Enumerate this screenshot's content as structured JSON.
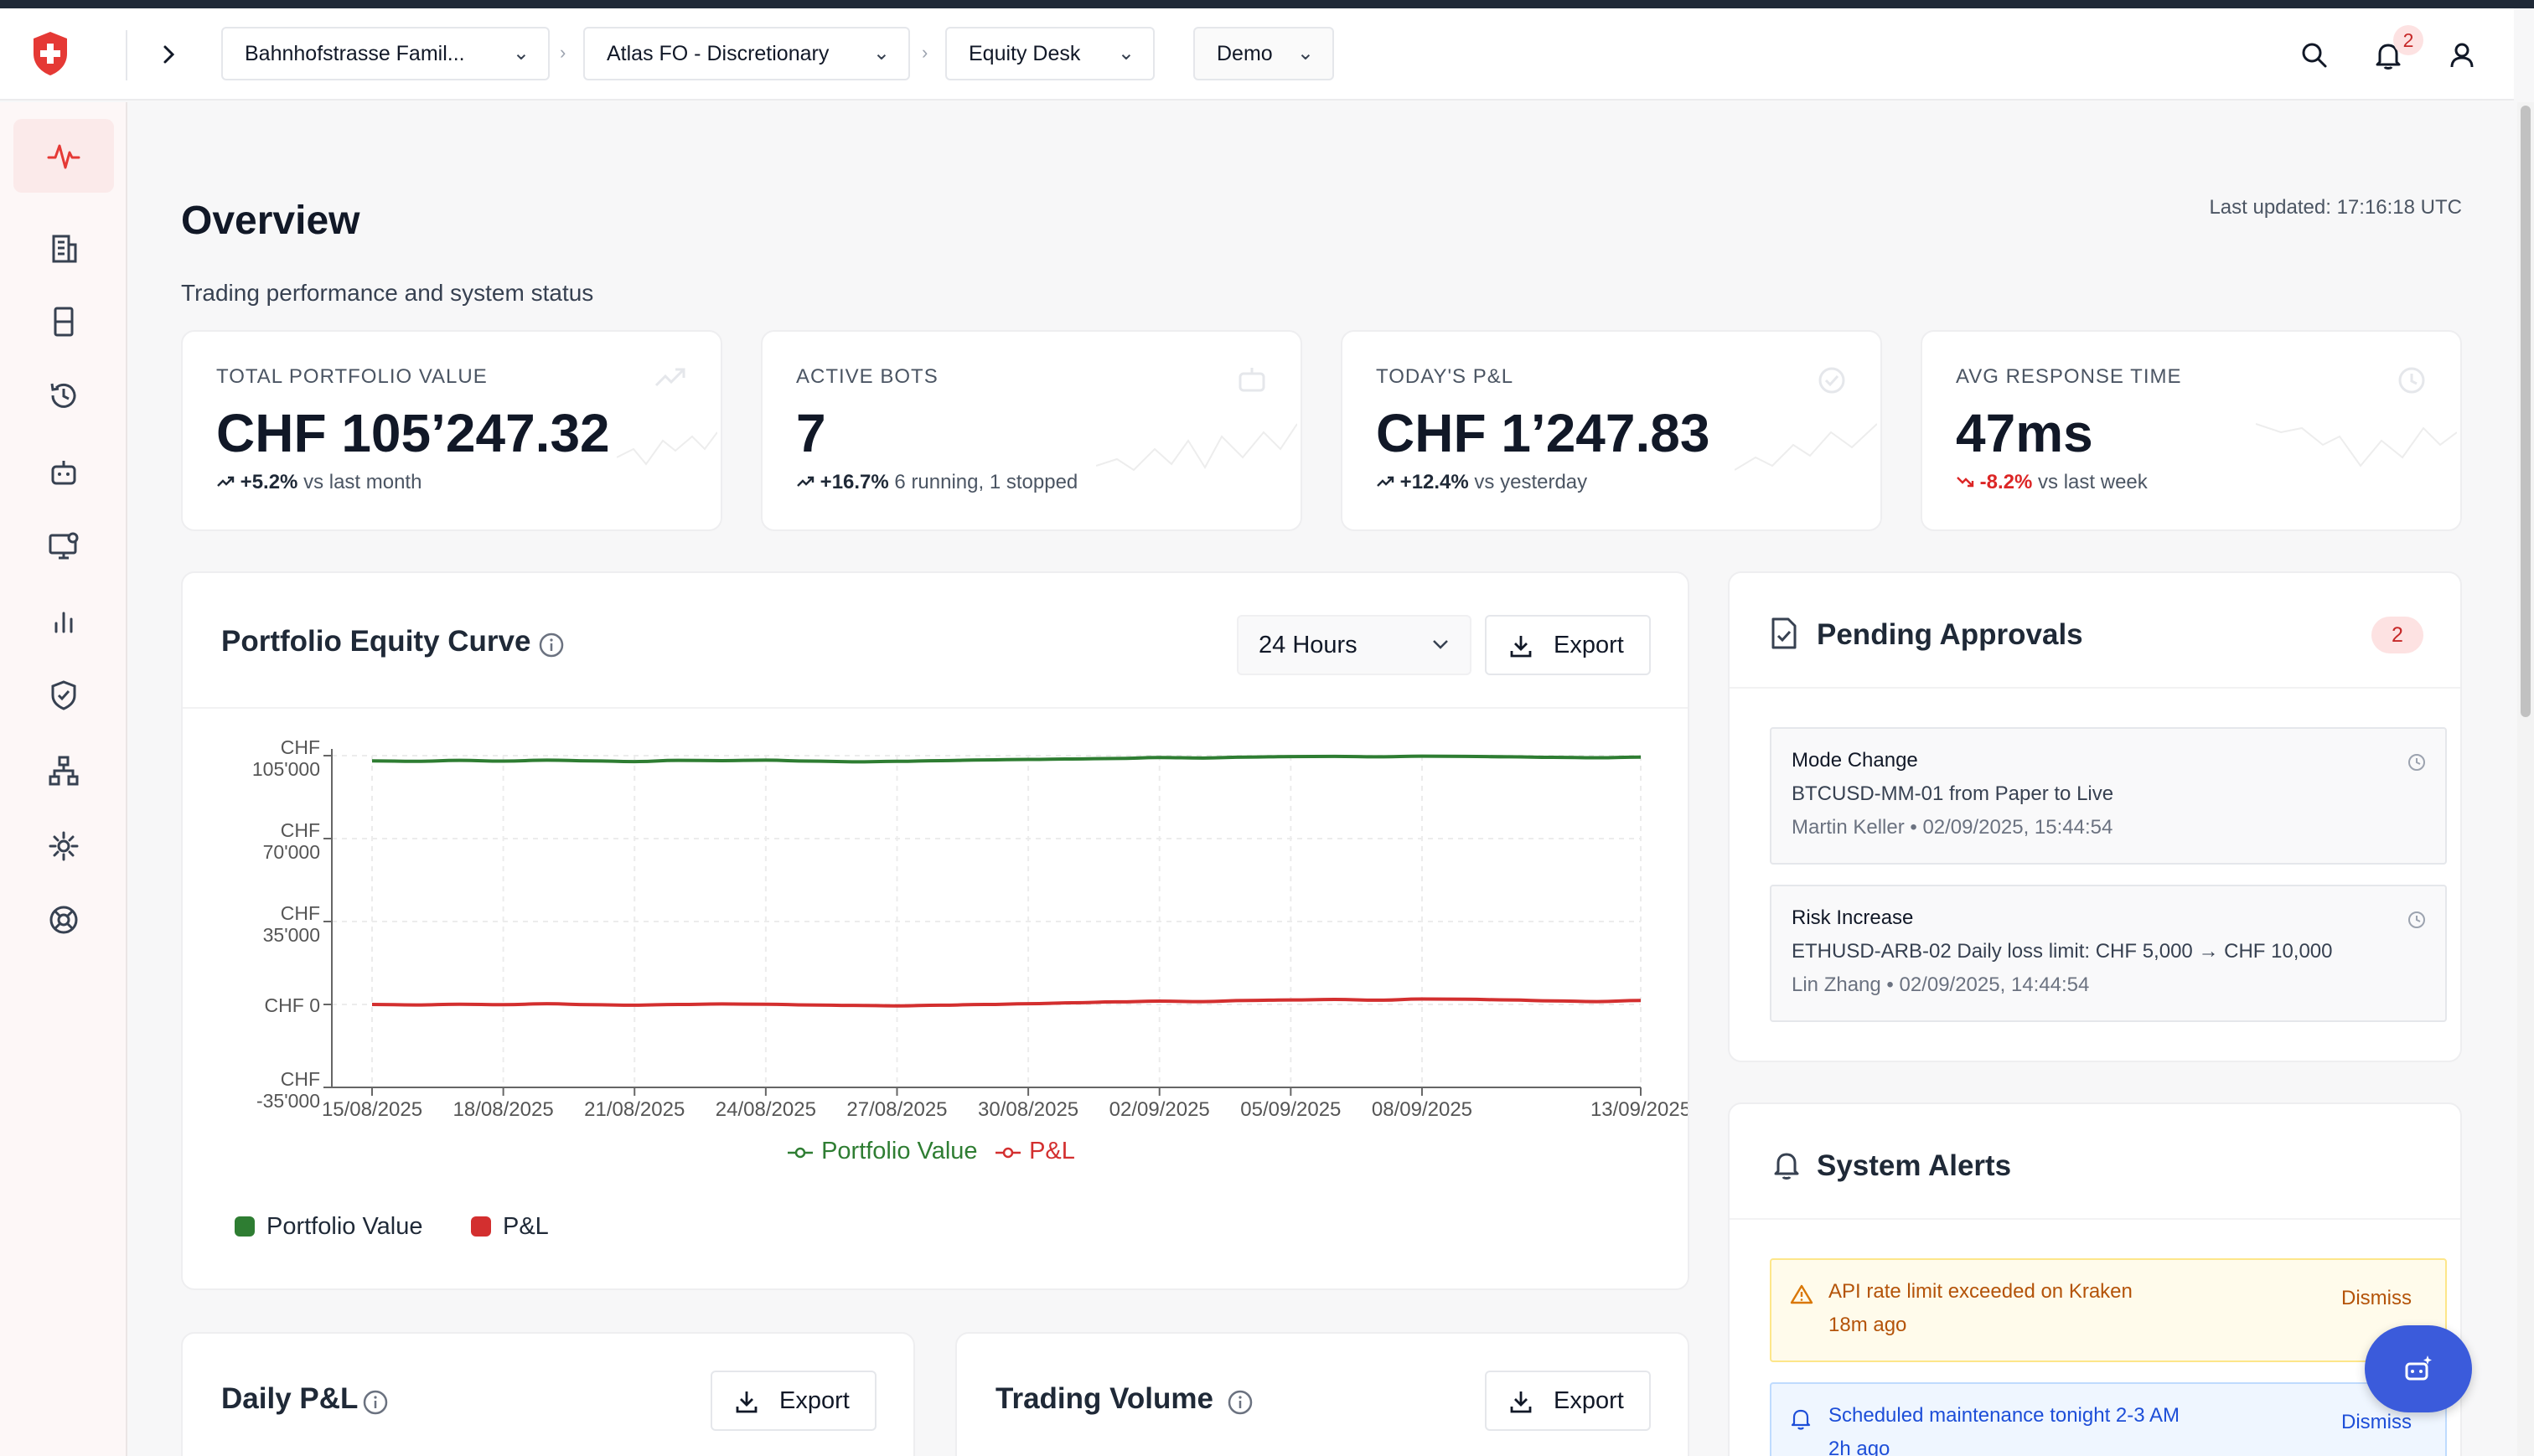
{
  "topbar": {
    "breadcrumbs": [
      {
        "label": "Bahnhofstrasse Famil..."
      },
      {
        "label": "Atlas FO - Discretionary"
      },
      {
        "label": "Equity Desk"
      },
      {
        "label": "Demo"
      }
    ],
    "notification_count": "2"
  },
  "header": {
    "title": "Overview",
    "subtitle": "Trading performance and system status",
    "last_updated": "Last updated: 17:16:18 UTC"
  },
  "kpis": [
    {
      "label": "TOTAL PORTFOLIO VALUE",
      "value": "CHF 105’247.32",
      "change": "+5.2%",
      "note": "vs last month",
      "icon": "trending-up-icon"
    },
    {
      "label": "ACTIVE BOTS",
      "value": "7",
      "change": "+16.7%",
      "note": "6 running, 1 stopped",
      "icon": "bot-icon"
    },
    {
      "label": "TODAY'S P&L",
      "value": "CHF 1’247.83",
      "change": "+12.4%",
      "note": "vs yesterday",
      "icon": "check-circle-icon"
    },
    {
      "label": "AVG RESPONSE TIME",
      "value": "47ms",
      "change": "-8.2%",
      "note": "vs last week",
      "icon": "clock-icon"
    }
  ],
  "equity": {
    "title": "Portfolio Equity Curve",
    "range": "24 Hours",
    "export_label": "Export",
    "legend": [
      {
        "name": "Portfolio Value",
        "color": "#2e7d32"
      },
      {
        "name": "P&L",
        "color": "#d32f2f"
      }
    ]
  },
  "chart_data": {
    "type": "line",
    "x": [
      "15/08/2025",
      "16/08/2025",
      "17/08/2025",
      "18/08/2025",
      "19/08/2025",
      "20/08/2025",
      "21/08/2025",
      "22/08/2025",
      "23/08/2025",
      "24/08/2025",
      "25/08/2025",
      "26/08/2025",
      "27/08/2025",
      "28/08/2025",
      "29/08/2025",
      "30/08/2025",
      "31/08/2025",
      "01/09/2025",
      "02/09/2025",
      "03/09/2025",
      "04/09/2025",
      "05/09/2025",
      "06/09/2025",
      "07/09/2025",
      "08/09/2025",
      "09/09/2025",
      "10/09/2025",
      "11/09/2025",
      "12/09/2025",
      "13/09/2025"
    ],
    "x_ticks": [
      "15/08/2025",
      "18/08/2025",
      "21/08/2025",
      "24/08/2025",
      "27/08/2025",
      "30/08/2025",
      "02/09/2025",
      "05/09/2025",
      "08/09/2025",
      "13/09/2025"
    ],
    "series": [
      {
        "name": "Portfolio Value",
        "color": "#2e7d32",
        "values": [
          102800,
          102600,
          103000,
          102700,
          103100,
          102800,
          102500,
          103000,
          102900,
          103100,
          102700,
          102400,
          102600,
          102900,
          103200,
          103400,
          103600,
          103800,
          104200,
          104000,
          104400,
          104600,
          104700,
          104500,
          104800,
          104700,
          104500,
          104300,
          104100,
          104400
        ]
      },
      {
        "name": "P&L",
        "color": "#d32f2f",
        "values": [
          0,
          -200,
          100,
          -100,
          300,
          -100,
          -300,
          0,
          200,
          100,
          -200,
          -400,
          -600,
          -300,
          0,
          300,
          700,
          1100,
          1400,
          1200,
          1700,
          1900,
          2100,
          1800,
          2300,
          2200,
          1900,
          1500,
          1200,
          1700
        ]
      }
    ],
    "y_ticks": [
      {
        "value": -35000,
        "top": "CHF",
        "bottom": "-35'000"
      },
      {
        "value": 0,
        "top": "",
        "bottom": "CHF 0"
      },
      {
        "value": 35000,
        "top": "CHF",
        "bottom": "35'000"
      },
      {
        "value": 70000,
        "top": "CHF",
        "bottom": "70'000"
      },
      {
        "value": 105000,
        "top": "CHF",
        "bottom": "105'000"
      }
    ],
    "ylim": [
      -35000,
      105000
    ],
    "grid": true,
    "legend_position": "bottom"
  },
  "approvals": {
    "title": "Pending Approvals",
    "count": "2",
    "items": [
      {
        "type": "Mode Change",
        "detail": "BTCUSD-MM-01 from Paper to Live",
        "meta": "Martin Keller • 02/09/2025, 15:44:54"
      },
      {
        "type": "Risk Increase",
        "detail": "ETHUSD-ARB-02 Daily loss limit: CHF 5,000 → CHF 10,000",
        "meta": "Lin Zhang • 02/09/2025, 14:44:54"
      }
    ]
  },
  "alerts": {
    "title": "System Alerts",
    "dismiss_label": "Dismiss",
    "items": [
      {
        "message": "API rate limit exceeded on Kraken",
        "time": "18m ago",
        "level": "warning"
      },
      {
        "message": "Scheduled maintenance tonight 2-3 AM",
        "time": "2h ago",
        "level": "info"
      }
    ]
  },
  "daily_pnl": {
    "title": "Daily P&L",
    "export_label": "Export"
  },
  "trading_volume": {
    "title": "Trading Volume",
    "export_label": "Export"
  },
  "colors": {
    "accent": "#e53935",
    "positive": "#2e7d32",
    "negative": "#dc2626",
    "fab": "#3b5bdb"
  }
}
